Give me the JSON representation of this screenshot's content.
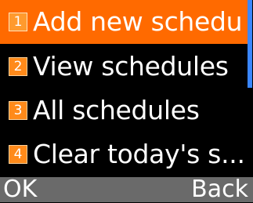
{
  "colors": {
    "background": "#000000",
    "selected_item": "#ff6a00",
    "number_badge": "#ff8a1a",
    "scrollbar_thumb": "#3a86ff",
    "softkey_bar": "#6a6a6a",
    "text": "#ffffff"
  },
  "menu": {
    "items": [
      {
        "number": "1",
        "label": "Add new schedu",
        "selected": true
      },
      {
        "number": "2",
        "label": "View schedules",
        "selected": false
      },
      {
        "number": "3",
        "label": "All schedules",
        "selected": false
      },
      {
        "number": "4",
        "label": "Clear today's s...",
        "selected": false
      }
    ]
  },
  "softkeys": {
    "left": "OK",
    "right": "Back"
  }
}
